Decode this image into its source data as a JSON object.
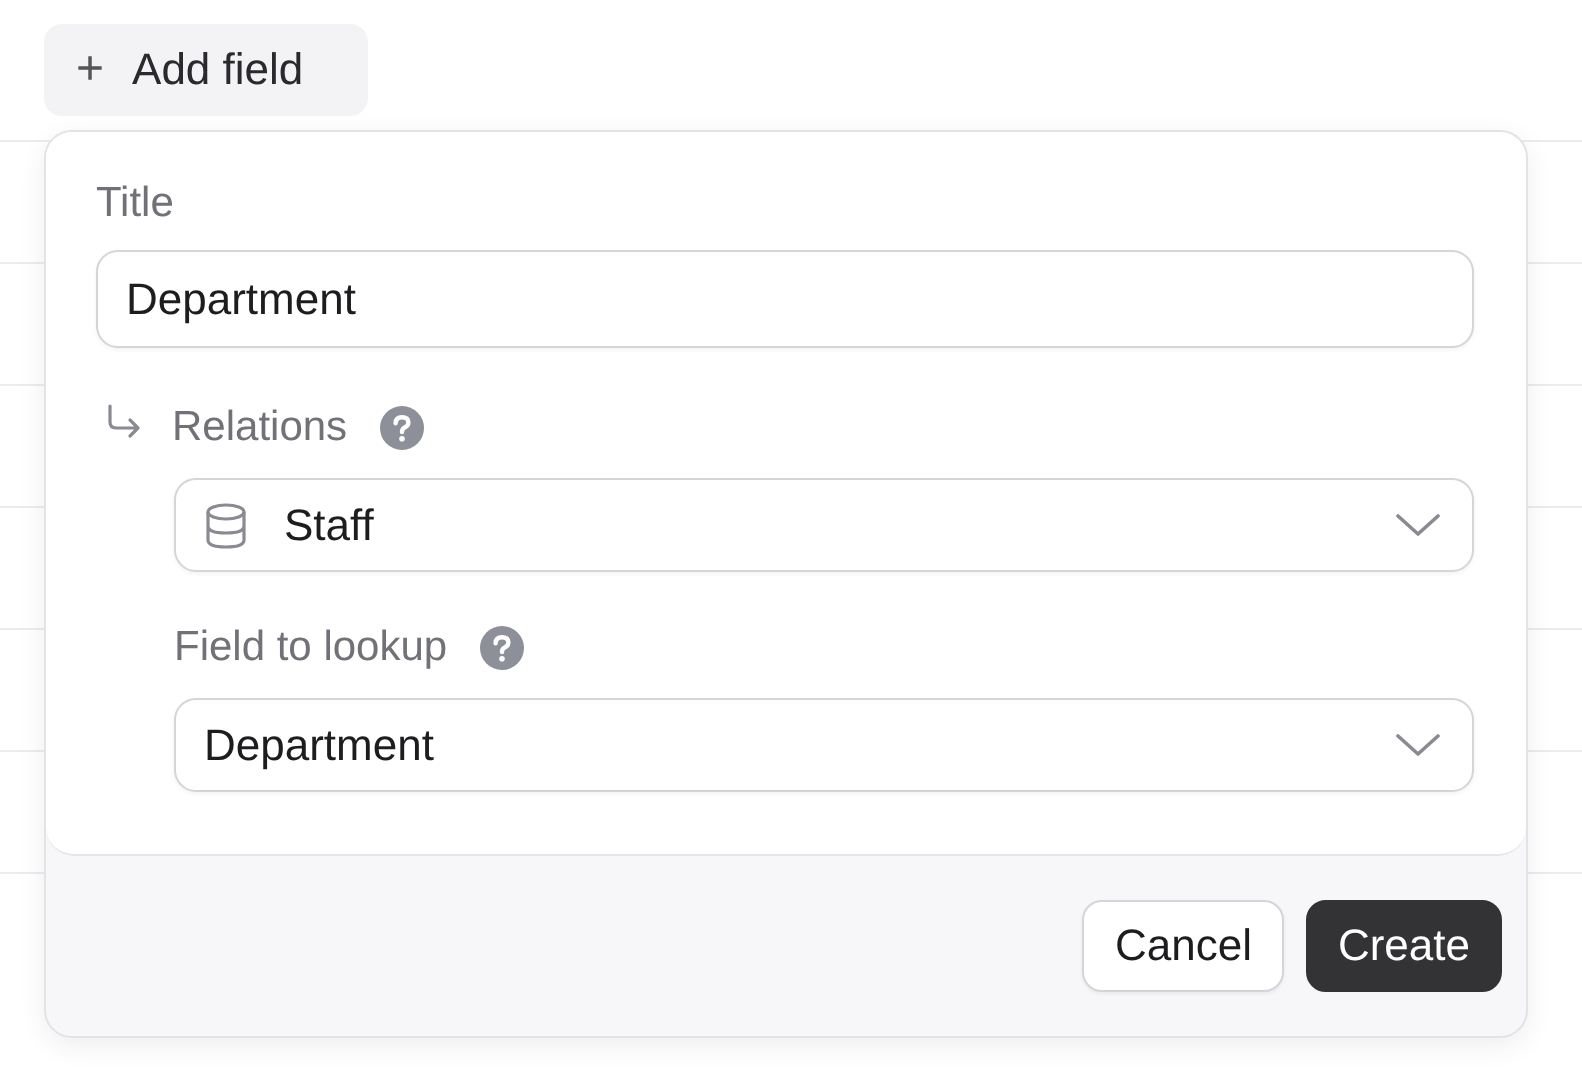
{
  "add_field_button": {
    "icon": "+",
    "label": "Add field"
  },
  "popover": {
    "title_field": {
      "label": "Title",
      "value": "Department"
    },
    "relations": {
      "label": "Relations",
      "value": "Staff"
    },
    "lookup": {
      "label": "Field to lookup",
      "value": "Department"
    },
    "buttons": [
      {
        "label": "Cancel",
        "kind": "secondary"
      },
      {
        "label": "Create",
        "kind": "primary"
      }
    ]
  }
}
